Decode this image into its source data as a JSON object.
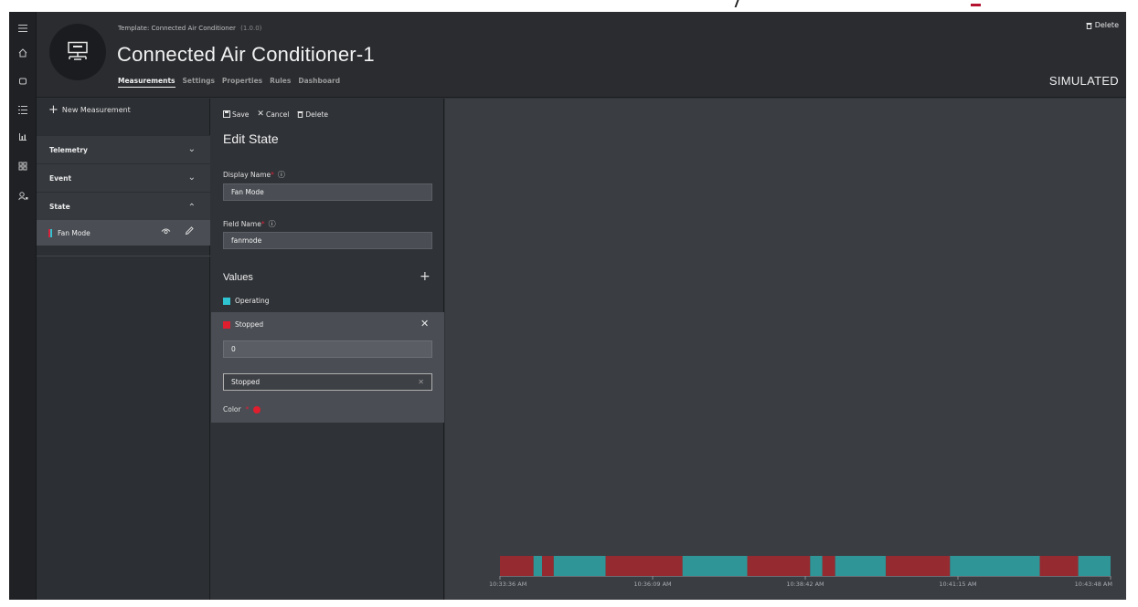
{
  "header": {
    "template_label": "Template:",
    "template_name": "Connected Air Conditioner",
    "template_version": "(1.0.0)",
    "device_name": "Connected Air Conditioner-1",
    "tabs": [
      "Measurements",
      "Settings",
      "Properties",
      "Rules",
      "Dashboard"
    ],
    "active_tab": "Measurements",
    "delete_label": "Delete",
    "mode": "SIMULATED"
  },
  "rail": {
    "icons": [
      "hamburger-icon",
      "home-icon",
      "device-icon",
      "list-icon",
      "analytics-icon",
      "apps-icon",
      "admin-icon"
    ]
  },
  "measurements": {
    "new_label": "New Measurement",
    "categories": [
      {
        "label": "Telemetry",
        "expanded": false
      },
      {
        "label": "Event",
        "expanded": false
      },
      {
        "label": "State",
        "expanded": true
      }
    ],
    "state_items": [
      {
        "label": "Fan Mode"
      }
    ]
  },
  "editor": {
    "toolbar": {
      "save": "Save",
      "cancel": "Cancel",
      "delete": "Delete"
    },
    "title": "Edit State",
    "display_name_label": "Display Name",
    "display_name_value": "Fan Mode",
    "field_name_label": "Field Name",
    "field_name_value": "fanmode",
    "values_label": "Values",
    "values": [
      {
        "label": "Operating",
        "color": "#2ec4d2"
      },
      {
        "label": "Stopped",
        "color": "#e01e2e",
        "value": "0",
        "display": "Stopped"
      }
    ],
    "color_label": "Color"
  },
  "chart_data": {
    "type": "timeline",
    "x_ticks": [
      "10:33:36 AM",
      "10:36:09 AM",
      "10:38:42 AM",
      "10:41:15 AM",
      "10:43:48 AM"
    ],
    "state_colors": {
      "Stopped": "#952a30",
      "Operating": "#2f9597"
    },
    "segments": [
      {
        "state": "Stopped",
        "start": 0.0,
        "end": 0.055
      },
      {
        "state": "Operating",
        "start": 0.055,
        "end": 0.069
      },
      {
        "state": "Stopped",
        "start": 0.069,
        "end": 0.088
      },
      {
        "state": "Operating",
        "start": 0.088,
        "end": 0.173
      },
      {
        "state": "Stopped",
        "start": 0.173,
        "end": 0.299
      },
      {
        "state": "Operating",
        "start": 0.299,
        "end": 0.405
      },
      {
        "state": "Stopped",
        "start": 0.405,
        "end": 0.508
      },
      {
        "state": "Operating",
        "start": 0.508,
        "end": 0.528
      },
      {
        "state": "Stopped",
        "start": 0.528,
        "end": 0.549
      },
      {
        "state": "Operating",
        "start": 0.549,
        "end": 0.632
      },
      {
        "state": "Stopped",
        "start": 0.632,
        "end": 0.737
      },
      {
        "state": "Operating",
        "start": 0.737,
        "end": 0.884
      },
      {
        "state": "Stopped",
        "start": 0.884,
        "end": 0.947
      },
      {
        "state": "Operating",
        "start": 0.947,
        "end": 1.0
      }
    ]
  }
}
